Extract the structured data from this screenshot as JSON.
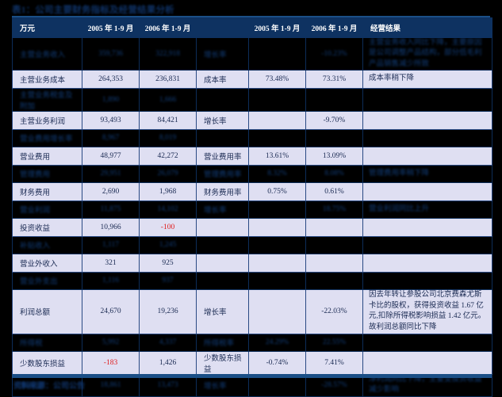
{
  "document": {
    "title": "表1：公司主要财务指标及经营结果分析",
    "title_legible": false,
    "source_caption": "资料来源：公司公告",
    "source_legible": false,
    "accent_color": "#1b4f86",
    "header_bg": "#0e3261",
    "row_bg": "#dfdff2",
    "negative_color": "#e01b1b",
    "text_color": "#1a2a52"
  },
  "table": {
    "columns": [
      {
        "key": "item",
        "label": "万元",
        "align": "left"
      },
      {
        "key": "v2005",
        "label": "2005 年 1-9 月",
        "align": "center"
      },
      {
        "key": "v2006",
        "label": "2006 年 1-9 月",
        "align": "center"
      },
      {
        "key": "ratio",
        "label": "",
        "align": "left"
      },
      {
        "key": "r2005",
        "label": "2005 年 1-9 月",
        "align": "center"
      },
      {
        "key": "r2006",
        "label": "2006 年 1-9 月",
        "align": "center"
      },
      {
        "key": "result",
        "label": "经营结果",
        "align": "left"
      }
    ],
    "rows": [
      {
        "legible": false,
        "tall": true,
        "item": "主营业务收入",
        "v2005": "359,736",
        "v2006": "322,918",
        "ratio": "增长率",
        "r2005": "",
        "r2006": "-10.23%",
        "result": "主营业务收入同比下降，主要原因是公司调整产品结构，部分低毛利产品销售减少所致"
      },
      {
        "legible": true,
        "tall": false,
        "item": "主营业务成本",
        "v2005": "264,353",
        "v2006": "236,831",
        "ratio": "成本率",
        "r2005": "73.48%",
        "r2006": "73.31%",
        "result": "成本率稍下降"
      },
      {
        "legible": false,
        "tall": true,
        "item": "主营业务税金及附加",
        "v2005": "1,890",
        "v2006": "1,666",
        "ratio": "",
        "r2005": "",
        "r2006": "",
        "result": ""
      },
      {
        "legible": true,
        "tall": false,
        "item": "主营业务利润",
        "v2005": "93,493",
        "v2006": "84,421",
        "ratio": "增长率",
        "r2005": "",
        "r2006": "-9.70%",
        "result": ""
      },
      {
        "legible": false,
        "tall": false,
        "item": "营业费用增长率",
        "v2005": "8,967",
        "v2006": "8,019",
        "ratio": "",
        "r2005": "",
        "r2006": "",
        "result": ""
      },
      {
        "legible": true,
        "tall": false,
        "item": "营业费用",
        "v2005": "48,977",
        "v2006": "42,272",
        "ratio": "营业费用率",
        "r2005": "13.61%",
        "r2006": "13.09%",
        "result": ""
      },
      {
        "legible": false,
        "tall": false,
        "item": "管理费用",
        "v2005": "29,951",
        "v2006": "26,079",
        "ratio": "管理费用率",
        "r2005": "8.32%",
        "r2006": "8.08%",
        "result": "管理费用率稍下降"
      },
      {
        "legible": true,
        "tall": false,
        "item": "财务费用",
        "v2005": "2,690",
        "v2006": "1,968",
        "ratio": "财务费用率",
        "r2005": "0.75%",
        "r2006": "0.61%",
        "result": ""
      },
      {
        "legible": false,
        "tall": false,
        "item": "营业利润",
        "v2005": "11,875",
        "v2006": "14,102",
        "ratio": "增长率",
        "r2005": "",
        "r2006": "18.75%",
        "result": "营业利润同比上升"
      },
      {
        "legible": true,
        "tall": false,
        "item": "投资收益",
        "v2005": "10,966",
        "v2006": "-100",
        "v2006_negative": true,
        "ratio": "",
        "r2005": "",
        "r2006": "",
        "result": ""
      },
      {
        "legible": false,
        "tall": false,
        "item": "补贴收入",
        "v2005": "1,117",
        "v2006": "1,245",
        "ratio": "",
        "r2005": "",
        "r2006": "",
        "result": ""
      },
      {
        "legible": true,
        "tall": false,
        "item": "营业外收入",
        "v2005": "321",
        "v2006": "925",
        "ratio": "",
        "r2005": "",
        "r2006": "",
        "result": ""
      },
      {
        "legible": false,
        "tall": false,
        "item": "营业外支出",
        "v2005": "1,116",
        "v2006": "937",
        "ratio": "",
        "r2005": "",
        "r2006": "",
        "result": ""
      },
      {
        "legible": true,
        "tall": true,
        "item": "利润总额",
        "v2005": "24,670",
        "v2006": "19,236",
        "ratio": "增长率",
        "r2005": "",
        "r2006": "-22.03%",
        "result": "因去年转让参股公司北京费森尤斯卡比的股权，获得投资收益 1.67 亿元,扣除所得税影响损益 1.42 亿元。故利润总额同比下降"
      },
      {
        "legible": false,
        "tall": false,
        "item": "所得税",
        "v2005": "5,992",
        "v2006": "4,337",
        "ratio": "所得税率",
        "r2005": "24.29%",
        "r2006": "22.55%",
        "result": ""
      },
      {
        "legible": true,
        "tall": false,
        "item": "少数股东损益",
        "v2005": "-183",
        "v2005_negative": true,
        "v2006": "1,426",
        "ratio": "少数股东损益",
        "r2005": "-0.74%",
        "r2006": "7.41%",
        "result": ""
      },
      {
        "legible": false,
        "tall": true,
        "item": "净利润",
        "v2005": "18,861",
        "v2006": "13,473",
        "ratio": "增长率",
        "r2005": "",
        "r2006": "-28.57%",
        "result": "净利润同比下降，主要受投资收益减少影响"
      }
    ]
  }
}
